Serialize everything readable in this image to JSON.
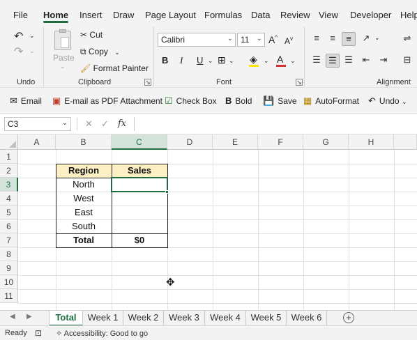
{
  "menu": {
    "tabs": [
      "File",
      "Home",
      "Insert",
      "Draw",
      "Page Layout",
      "Formulas",
      "Data",
      "Review",
      "View",
      "Developer",
      "Help"
    ],
    "active": "Home"
  },
  "ribbon": {
    "undo_group": "Undo",
    "clipboard": {
      "paste": "Paste",
      "cut": "Cut",
      "copy": "Copy",
      "format_painter": "Format Painter",
      "label": "Clipboard"
    },
    "font": {
      "name": "Calibri",
      "size": "11",
      "bold": "B",
      "italic": "I",
      "underline": "U",
      "grow": "A",
      "shrink": "A",
      "color_letter": "A",
      "label": "Font",
      "font_color": "#d13438",
      "fill_color": "#ffe600"
    },
    "alignment": {
      "label": "Alignment"
    }
  },
  "quick_access": {
    "email": "Email",
    "pdf": "E-mail as PDF Attachment",
    "checkbox": "Check Box",
    "bold": "Bold",
    "save": "Save",
    "autoformat": "AutoFormat",
    "undo": "Undo"
  },
  "formula_bar": {
    "name_box": "C3",
    "value": ""
  },
  "grid": {
    "columns": [
      "A",
      "B",
      "C",
      "D",
      "E",
      "F",
      "G",
      "H"
    ],
    "selected_column": "C",
    "rows": [
      "1",
      "2",
      "3",
      "4",
      "5",
      "6",
      "7",
      "8",
      "9",
      "10",
      "11"
    ],
    "selected_row": "3",
    "table": {
      "header": [
        "Region",
        "Sales"
      ],
      "rows": [
        [
          "North",
          ""
        ],
        [
          "West",
          ""
        ],
        [
          "East",
          ""
        ],
        [
          "South",
          ""
        ]
      ],
      "total": [
        "Total",
        "$0"
      ],
      "header_fill": "#fcefc3"
    }
  },
  "sheets": {
    "tabs": [
      "Total",
      "Week 1",
      "Week 2",
      "Week 3",
      "Week 4",
      "Week 5",
      "Week 6"
    ],
    "active": "Total",
    "add": "+"
  },
  "status": {
    "ready": "Ready",
    "accessibility": "Accessibility: Good to go"
  },
  "accent": "#1e6e42"
}
